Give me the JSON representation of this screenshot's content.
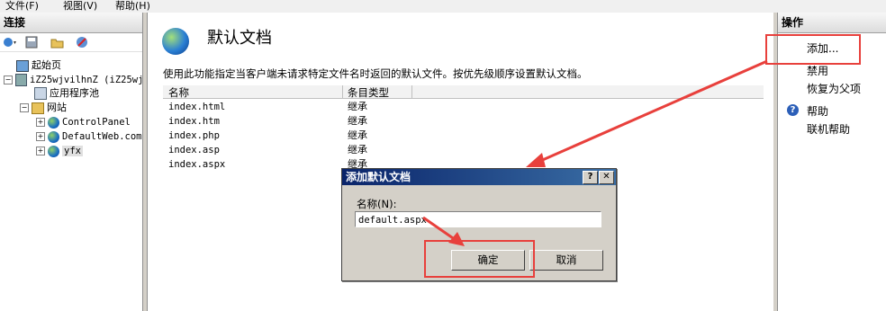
{
  "menu": {
    "file": "文件(F)",
    "view": "视图(V)",
    "help": "帮助(H)"
  },
  "connections": {
    "title": "连接",
    "tree": {
      "start": "起始页",
      "server": "iZ25wjvilhnZ (iZ25wj",
      "apppools": "应用程序池",
      "sites": "网站",
      "site1": "ControlPanel",
      "site2": "DefaultWeb.com",
      "site3": "yfx"
    }
  },
  "main": {
    "title": "默认文档",
    "description": "使用此功能指定当客户端未请求特定文件名时返回的默认文件。按优先级顺序设置默认文档。",
    "columns": {
      "name": "名称",
      "type": "条目类型"
    },
    "rows": [
      {
        "name": "index.html",
        "type": "继承"
      },
      {
        "name": "index.htm",
        "type": "继承"
      },
      {
        "name": "index.php",
        "type": "继承"
      },
      {
        "name": "index.asp",
        "type": "继承"
      },
      {
        "name": "index.aspx",
        "type": "继承"
      }
    ]
  },
  "actions": {
    "title": "操作",
    "add": "添加...",
    "disable": "禁用",
    "revert": "恢复为父项",
    "help": "帮助",
    "online_help": "联机帮助"
  },
  "dialog": {
    "title": "添加默认文档",
    "help_btn": "?",
    "close_btn": "✕",
    "name_label": "名称(N):",
    "name_value": "default.aspx",
    "ok": "确定",
    "cancel": "取消"
  },
  "colors": {
    "annotation": "#e8403c",
    "dialog_title": "#0a246a"
  }
}
